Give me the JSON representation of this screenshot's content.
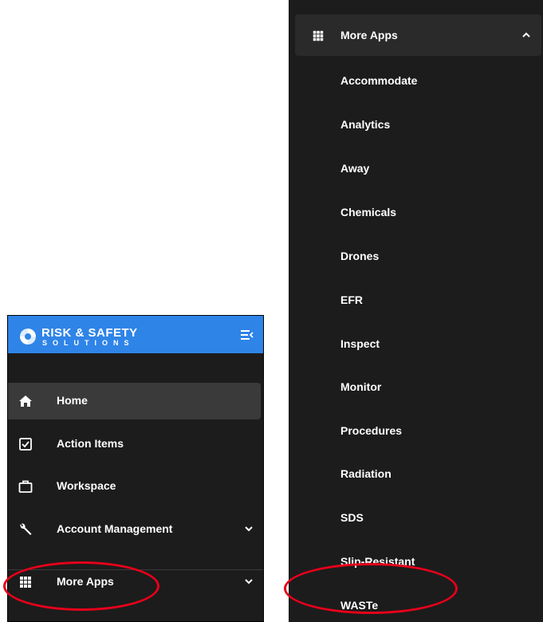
{
  "brand": {
    "title": "RISK & SAFETY",
    "subtitle": "SOLUTIONS",
    "header_color": "#2f84e8"
  },
  "sidebar": {
    "items": [
      {
        "label": "Home",
        "icon": "home-icon",
        "active": true
      },
      {
        "label": "Action Items",
        "icon": "checkbox-icon"
      },
      {
        "label": "Workspace",
        "icon": "briefcase-icon"
      },
      {
        "label": "Account Management",
        "icon": "wrench-icon",
        "expandable": true
      },
      {
        "label": "More Apps",
        "icon": "grid-icon",
        "expandable": true
      }
    ]
  },
  "more_apps_menu": {
    "header": "More Apps",
    "expanded": true,
    "apps": [
      "Accommodate",
      "Analytics",
      "Away",
      "Chemicals",
      "Drones",
      "EFR",
      "Inspect",
      "Monitor",
      "Procedures",
      "Radiation",
      "SDS",
      "Slip-Resistant",
      "WASTe"
    ]
  },
  "annotations": {
    "highlight_color": "#e6001a",
    "highlighted": [
      "More Apps",
      "WASTe"
    ]
  }
}
